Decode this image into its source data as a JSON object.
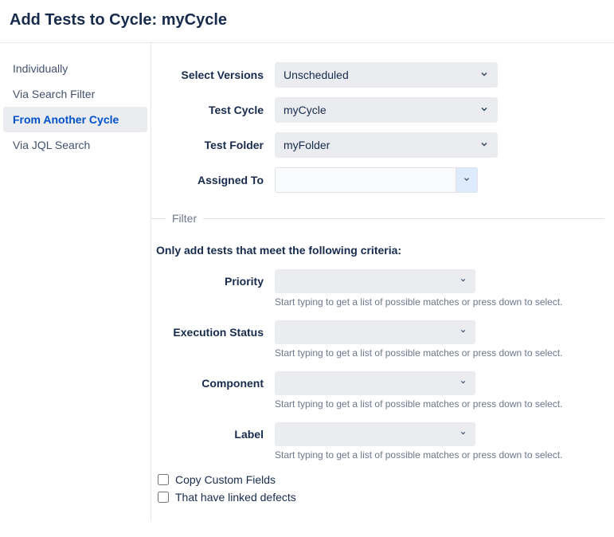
{
  "header": {
    "title": "Add Tests to Cycle: myCycle"
  },
  "sidebar": {
    "items": [
      {
        "label": "Individually",
        "active": false
      },
      {
        "label": "Via Search Filter",
        "active": false
      },
      {
        "label": "From Another Cycle",
        "active": true
      },
      {
        "label": "Via JQL Search",
        "active": false
      }
    ]
  },
  "form": {
    "selectVersions": {
      "label": "Select Versions",
      "value": "Unscheduled"
    },
    "testCycle": {
      "label": "Test Cycle",
      "value": "myCycle"
    },
    "testFolder": {
      "label": "Test Folder",
      "value": "myFolder"
    },
    "assignedTo": {
      "label": "Assigned To",
      "value": ""
    }
  },
  "filter": {
    "legend": "Filter",
    "criteriaText": "Only add tests that meet the following criteria:",
    "hint": "Start typing to get a list of possible matches or press down to select.",
    "fields": [
      {
        "label": "Priority"
      },
      {
        "label": "Execution Status"
      },
      {
        "label": "Component"
      },
      {
        "label": "Label"
      }
    ],
    "copyCustomFields": {
      "label": "Copy Custom Fields",
      "checked": false
    },
    "linkedDefects": {
      "label": "That have linked defects",
      "checked": false
    }
  }
}
